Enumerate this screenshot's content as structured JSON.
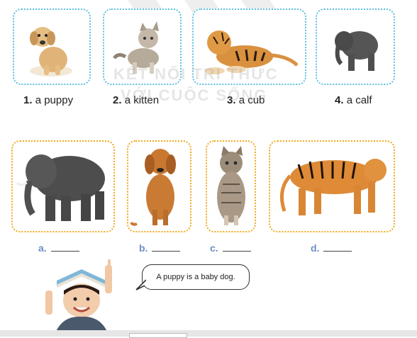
{
  "vocab": [
    {
      "num": "1.",
      "word": "a puppy"
    },
    {
      "num": "2.",
      "word": "a kitten"
    },
    {
      "num": "3.",
      "word": "a cub"
    },
    {
      "num": "4.",
      "word": "a calf"
    }
  ],
  "answers": [
    {
      "letter": "a."
    },
    {
      "letter": "b."
    },
    {
      "letter": "c."
    },
    {
      "letter": "d."
    }
  ],
  "speech": {
    "text": "A puppy is a baby dog."
  },
  "watermark": {
    "line1": "KẾT NỐI TRI THỨC",
    "line2": "VỚI CUỘC SỐNG"
  },
  "colors": {
    "blue_border": "#5bc0e0",
    "orange_border": "#f2a81d",
    "answer_letter": "#6d8fc4"
  }
}
